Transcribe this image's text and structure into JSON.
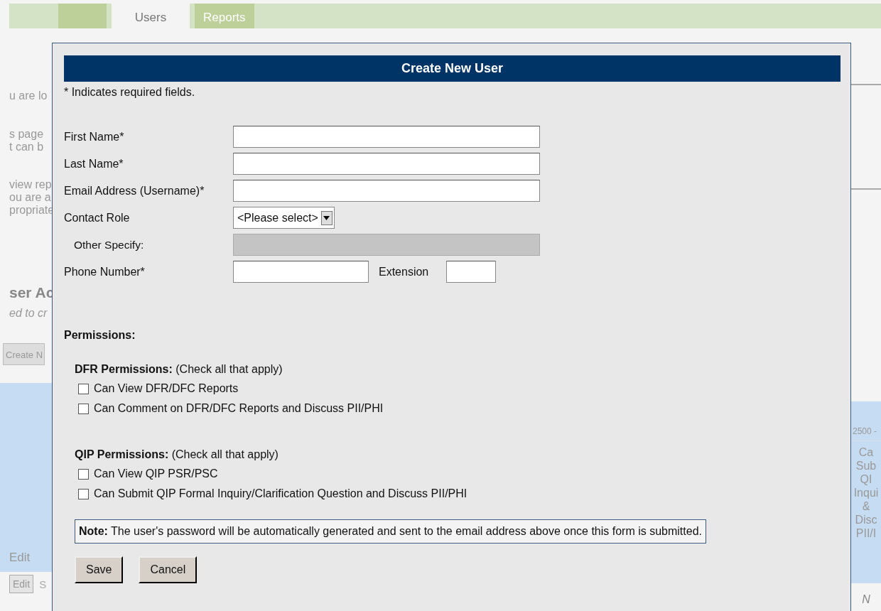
{
  "nav_tabs": [
    {
      "label": "Users",
      "selected": true
    },
    {
      "label": "Reports",
      "selected": false
    }
  ],
  "background": {
    "intro_lines": [
      "u are lo",
      "s page",
      "t can b",
      "view rep",
      "ou are a",
      "propriate"
    ],
    "section_title": "ser Ac",
    "section_subtitle": "ed to cr",
    "create_button": "Create N",
    "table_header_left": "Edit",
    "row_button": "Edit",
    "row_text": "S",
    "right_header": "2500 -",
    "right_column_lines": [
      "Ca",
      "Sub",
      "QI",
      "Inqui",
      "&",
      "Disc",
      "PII/I"
    ],
    "right_cell": "N"
  },
  "dialog": {
    "title": "Create New User",
    "required_note": "* Indicates required fields.",
    "fields": [
      {
        "label": "First Name*",
        "kind": "text"
      },
      {
        "label": "Last Name*",
        "kind": "text"
      },
      {
        "label": "Email Address (Username)*",
        "kind": "text"
      },
      {
        "label": "Contact Role",
        "kind": "select",
        "value": "<Please select>"
      },
      {
        "label": "Other Specify:",
        "kind": "disabled"
      },
      {
        "label": "Phone Number*",
        "kind": "phone",
        "extension_label": "Extension"
      }
    ],
    "permissions_heading": "Permissions:",
    "groups": [
      {
        "title": "DFR Permissions:",
        "hint": "(Check all that apply)",
        "options": [
          {
            "label": "Can View DFR/DFC Reports",
            "checked": false
          },
          {
            "label": "Can Comment on DFR/DFC Reports and Discuss PII/PHI",
            "checked": false
          }
        ]
      },
      {
        "title": "QIP Permissions:",
        "hint": "(Check all that apply)",
        "options": [
          {
            "label": "Can View QIP PSR/PSC",
            "checked": false
          },
          {
            "label": "Can Submit QIP Formal Inquiry/Clarification Question and Discuss PII/PHI",
            "checked": false
          }
        ]
      }
    ],
    "note": "**Note:** The user's password will be automatically generated and sent to the email address above once this form is submitted.",
    "buttons": [
      "Save",
      "Cancel"
    ]
  }
}
